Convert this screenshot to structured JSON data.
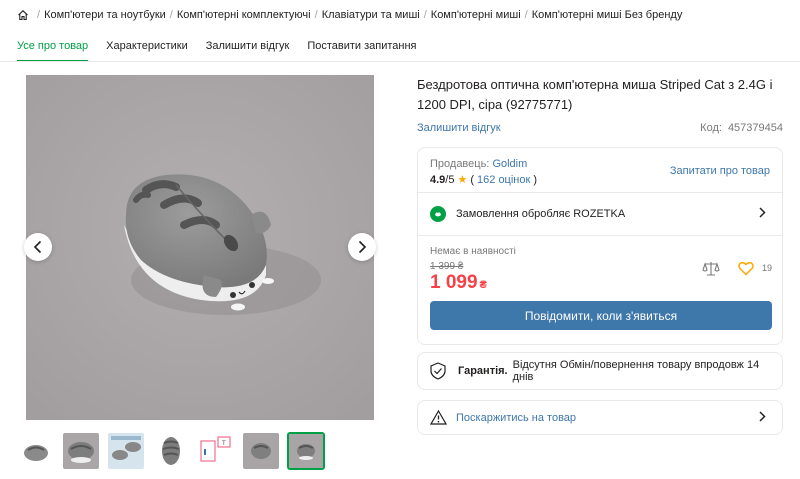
{
  "breadcrumb": {
    "items": [
      "Комп'ютери та ноутбуки",
      "Комп'ютерні комплектуючі",
      "Клавіатури та миші",
      "Комп'ютерні миші",
      "Комп'ютерні миші Без бренду"
    ]
  },
  "tabs": [
    {
      "label": "Усе про товар",
      "active": true
    },
    {
      "label": "Характеристики"
    },
    {
      "label": "Залишити відгук"
    },
    {
      "label": "Поставити запитання"
    }
  ],
  "product": {
    "title": "Бездротова оптична комп'ютерна миша Striped Cat з 2.4G і 1200 DPI, сіра (92775771)",
    "review_link": "Залишити відгук",
    "code_label": "Код:",
    "code_value": "457379454"
  },
  "seller": {
    "label": "Продавець:",
    "name": "Goldim",
    "rating": "4.9",
    "rating_max": "/5",
    "reviews_open": "(",
    "reviews_count": "162 оцінок",
    "reviews_close": ")",
    "ask_link": "Запитати про товар"
  },
  "rozetka": {
    "text": "Замовлення обробляє ROZETKA"
  },
  "price": {
    "stock_status": "Немає в наявності",
    "old_price": "1 399 ₴",
    "current": "1 099",
    "currency": "₴",
    "favorites_count": "19",
    "notify_button": "Повідомити, коли з'явиться"
  },
  "warranty": {
    "label": "Гарантія.",
    "text": "Відсутня Обмін/повернення товару впродовж 14 днів"
  },
  "complain": {
    "text": "Поскаржитись на товар"
  },
  "colors": {
    "accent_green": "#00a046",
    "link_blue": "#3e77aa",
    "price_red": "#f84147",
    "star": "#ffa900"
  }
}
